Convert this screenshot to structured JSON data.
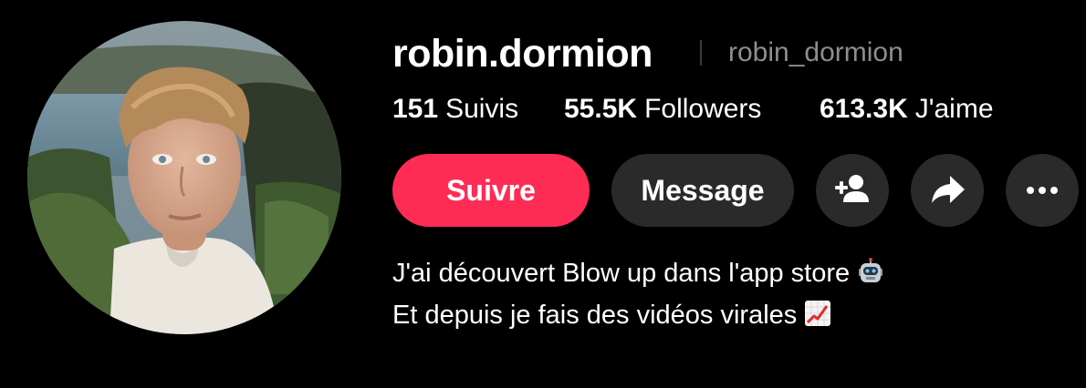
{
  "profile": {
    "display_name": "robin.dormion",
    "username": "robin_dormion",
    "avatar_icon": "profile-photo"
  },
  "stats": [
    {
      "value": "151",
      "label": "Suivis"
    },
    {
      "value": "55.5K",
      "label": "Followers"
    },
    {
      "value": "613.3K",
      "label": "J'aime"
    }
  ],
  "actions": {
    "follow_label": "Suivre",
    "message_label": "Message",
    "add_friend_icon": "add-user-icon",
    "share_icon": "share-icon",
    "more_icon": "more-icon"
  },
  "bio": {
    "line1": "J'ai découvert Blow up dans l'app store",
    "line1_emoji": "robot-emoji",
    "line2": "Et depuis je fais des vidéos virales",
    "line2_emoji": "chart-increasing-emoji"
  },
  "colors": {
    "background": "#000000",
    "accent": "#fe2c55",
    "secondary_button": "#2a2a2a",
    "muted_text": "#8e8e8e"
  }
}
